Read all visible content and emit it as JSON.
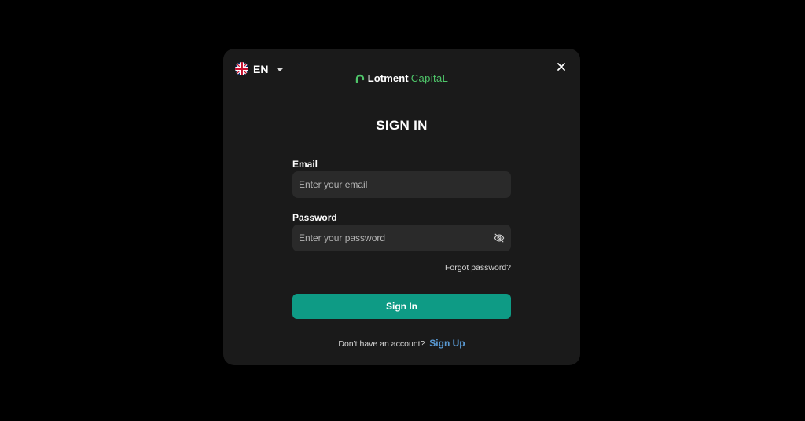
{
  "language": {
    "code": "EN",
    "flag_icon": "uk-flag-icon",
    "dropdown_icon": "caret-down-icon"
  },
  "close_icon": "close-icon",
  "brand": {
    "name_bold": "Lotment",
    "name_light": "CapitaL",
    "logo_icon": "lotment-logo-icon",
    "accent_color": "#4fc66a"
  },
  "title": "SIGN IN",
  "form": {
    "email": {
      "label": "Email",
      "value": "",
      "placeholder": "Enter your email"
    },
    "password": {
      "label": "Password",
      "value": "",
      "placeholder": "Enter your password",
      "toggle_icon": "eye-off-icon"
    },
    "forgot_link": "Forgot password?",
    "submit_label": "Sign In",
    "submit_color": "#0e9b85"
  },
  "footer": {
    "prompt": "Don't have an account?",
    "signup_link": "Sign Up",
    "link_color": "#5a9bd5"
  },
  "colors": {
    "page_background": "#000000",
    "modal_background": "#1a1a1a",
    "input_background": "#2a2a2a"
  }
}
